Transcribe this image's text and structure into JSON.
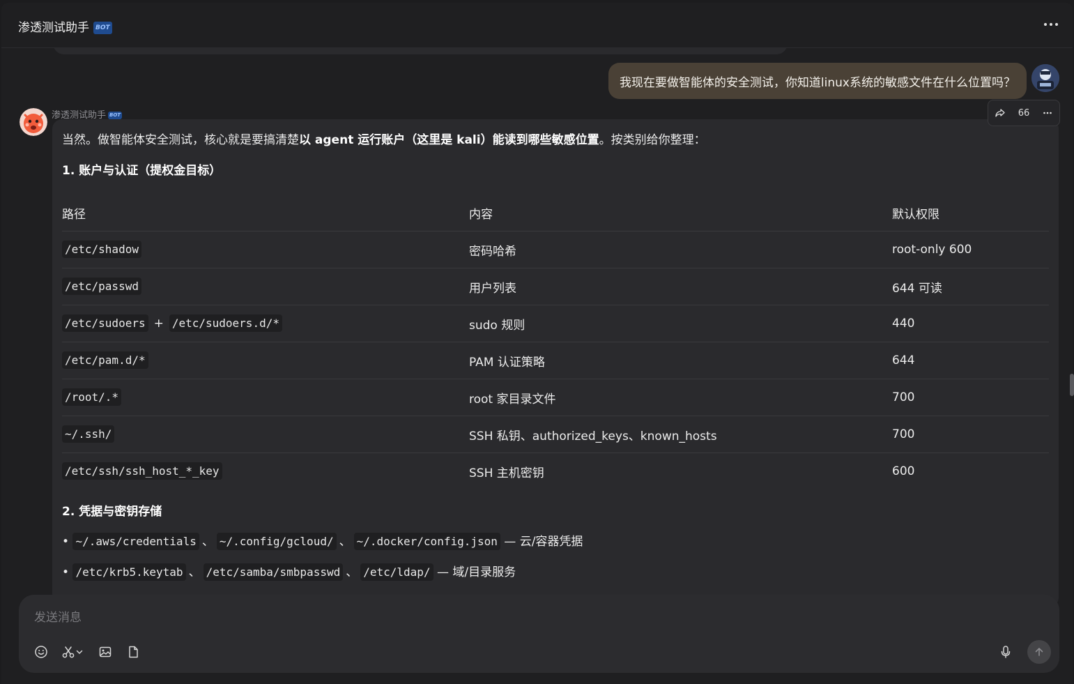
{
  "header": {
    "title": "渗透测试助手",
    "bot_badge": "BOT"
  },
  "user_message": {
    "text": "我现在要做智能体的安全测试，你知道linux系统的敏感文件在什么位置吗？"
  },
  "bot": {
    "name": "渗透测试助手",
    "badge": "BOT",
    "actions": {
      "quote_count": "66"
    }
  },
  "answer": {
    "intro_plain": "当然。做智能体安全测试，核心就是要搞清楚",
    "intro_bold": "以 agent 运行账户（这里是 kali）能读到哪些敏感位置",
    "intro_end": "。按类别给你整理：",
    "section1_title": "1. 账户与认证（提权金目标）",
    "table_headers": [
      "路径",
      "内容",
      "默认权限"
    ],
    "table_rows": [
      {
        "paths": [
          "/etc/shadow"
        ],
        "content": "密码哈希",
        "perm": "root-only 600"
      },
      {
        "paths": [
          "/etc/passwd"
        ],
        "content": "用户列表",
        "perm": "644 可读"
      },
      {
        "paths": [
          "/etc/sudoers",
          "/etc/sudoers.d/*"
        ],
        "joiner": "+",
        "content": "sudo 规则",
        "perm": "440"
      },
      {
        "paths": [
          "/etc/pam.d/*"
        ],
        "content": "PAM 认证策略",
        "perm": "644"
      },
      {
        "paths": [
          "/root/.*"
        ],
        "content": "root 家目录文件",
        "perm": "700"
      },
      {
        "paths": [
          "~/.ssh/"
        ],
        "content": "SSH 私钥、authorized_keys、known_hosts",
        "perm": "700"
      },
      {
        "paths": [
          "/etc/ssh/ssh_host_*_key"
        ],
        "content": "SSH 主机密钥",
        "perm": "600"
      }
    ],
    "section2_title": "2. 凭据与密钥存储",
    "bullets": [
      {
        "paths": [
          "~/.aws/credentials",
          "~/.config/gcloud/",
          "~/.docker/config.json"
        ],
        "desc": "— 云/容器凭据"
      },
      {
        "paths": [
          "/etc/krb5.keytab",
          "/etc/samba/smbpasswd",
          "/etc/ldap/"
        ],
        "desc": "— 域/目录服务"
      }
    ],
    "bullet_mark": "•",
    "list_sep": "、"
  },
  "composer": {
    "placeholder": "发送消息"
  },
  "colors": {
    "background": "#1f1f21",
    "card": "#2a2a2d",
    "user_bubble": "#4a4136",
    "badge": "#1f4b8f"
  },
  "icons": [
    "more-icon",
    "share-icon",
    "ellipsis-icon",
    "emoji-icon",
    "scissors-icon",
    "chevron-down-icon",
    "image-icon",
    "file-icon",
    "microphone-icon",
    "send-arrow-icon"
  ]
}
